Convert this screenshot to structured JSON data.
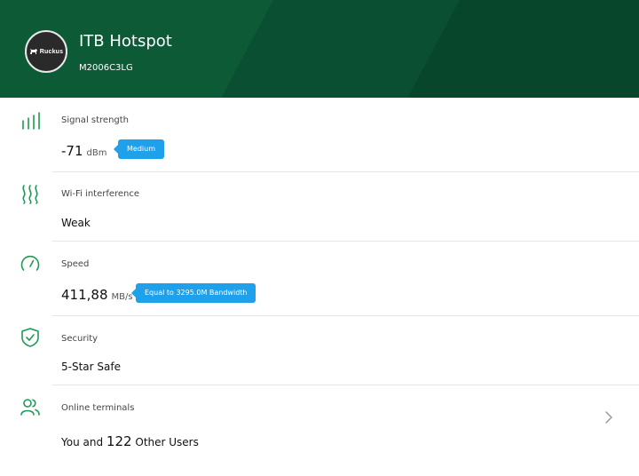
{
  "header": {
    "logo_text": "Ruckus",
    "title": "ITB Hotspot",
    "model": "M2006C3LG"
  },
  "items": [
    {
      "icon": "signal-bars-icon",
      "label": "Signal strength",
      "value": "-71",
      "unit": "dBm",
      "badge": "Medium"
    },
    {
      "icon": "interference-waves-icon",
      "label": "Wi-Fi interference",
      "value": "Weak"
    },
    {
      "icon": "speedometer-icon",
      "label": "Speed",
      "value": "411,88",
      "unit": "MB/s",
      "badge": "Equal to 3295.0M Bandwidth"
    },
    {
      "icon": "shield-check-icon",
      "label": "Security",
      "value": "5-Star Safe"
    },
    {
      "icon": "users-icon",
      "label": "Online terminals",
      "value_prefix": "You and",
      "value_count": "122",
      "value_suffix": "Other Users"
    }
  ],
  "colors": {
    "header_green": "#0d5a37",
    "icon_green": "#1f9a55",
    "badge_blue": "#1ea0ea"
  }
}
